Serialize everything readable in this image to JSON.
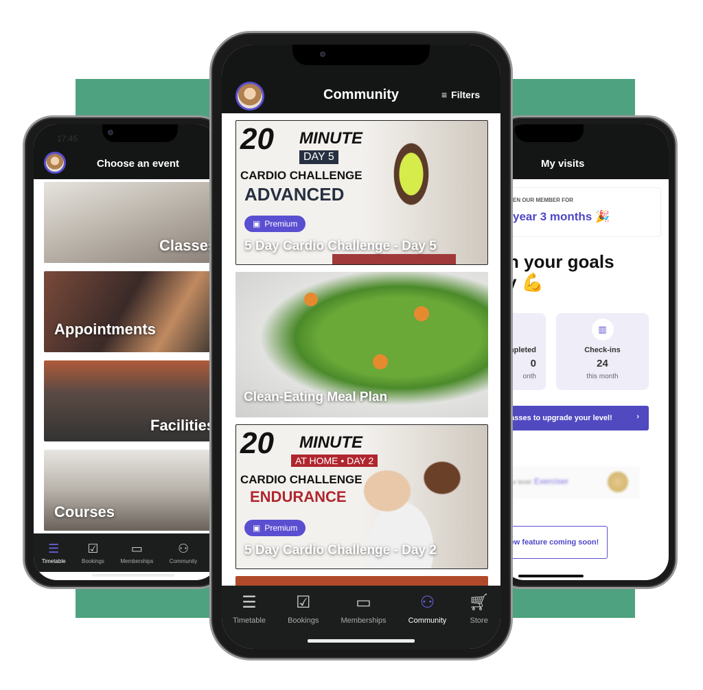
{
  "colors": {
    "accent": "#5a4fd0",
    "green": "#4fa27f",
    "dark": "#141616"
  },
  "left_phone": {
    "status_time": "17:45",
    "title": "Choose an event",
    "cards": [
      {
        "label": "Classes"
      },
      {
        "label": "Appointments"
      },
      {
        "label": "Facilities"
      },
      {
        "label": "Courses"
      }
    ],
    "nav": [
      {
        "label": "Timetable",
        "icon": "list-icon",
        "active": true
      },
      {
        "label": "Bookings",
        "icon": "clipboard-check-icon"
      },
      {
        "label": "Memberships",
        "icon": "membership-card-icon"
      },
      {
        "label": "Community",
        "icon": "people-icon"
      }
    ]
  },
  "center_phone": {
    "title": "Community",
    "filters_label": "Filters",
    "cards": [
      {
        "big": "20",
        "word": "MINUTE",
        "tag": "DAY 5",
        "line1": "CARDIO CHALLENGE",
        "line2": "ADVANCED",
        "badge": "Premium",
        "title": "5 Day Cardio Challenge - Day 5"
      },
      {
        "title": "Clean-Eating Meal Plan"
      },
      {
        "big": "20",
        "word": "MINUTE",
        "tag": "AT HOME • DAY 2",
        "line1": "CARDIO CHALLENGE",
        "line2": "ENDURANCE",
        "badge": "Premium",
        "title": "5 Day Cardio Challenge - Day 2"
      }
    ],
    "nav": [
      {
        "label": "Timetable",
        "icon": "list-icon"
      },
      {
        "label": "Bookings",
        "icon": "clipboard-check-icon"
      },
      {
        "label": "Memberships",
        "icon": "membership-card-icon"
      },
      {
        "label": "Community",
        "icon": "people-icon",
        "active": true
      },
      {
        "label": "Store",
        "icon": "cart-icon"
      }
    ]
  },
  "right_phone": {
    "title": "My visits",
    "member_label": "EN OUR MEMBER FOR",
    "member_value": "year 3 months 🎉",
    "goals_line1": "n your goals",
    "goals_line2": "y 💪",
    "stats": [
      {
        "label": "mpleted",
        "value": "0",
        "sub": "onth"
      },
      {
        "label": "Check-ins",
        "value": "24",
        "sub": "this month"
      }
    ],
    "upgrade_text": "classes to upgrade your level!",
    "level_label": "Your level:",
    "level_value": "Exerciser",
    "feature_button": "New feature coming soon!"
  }
}
